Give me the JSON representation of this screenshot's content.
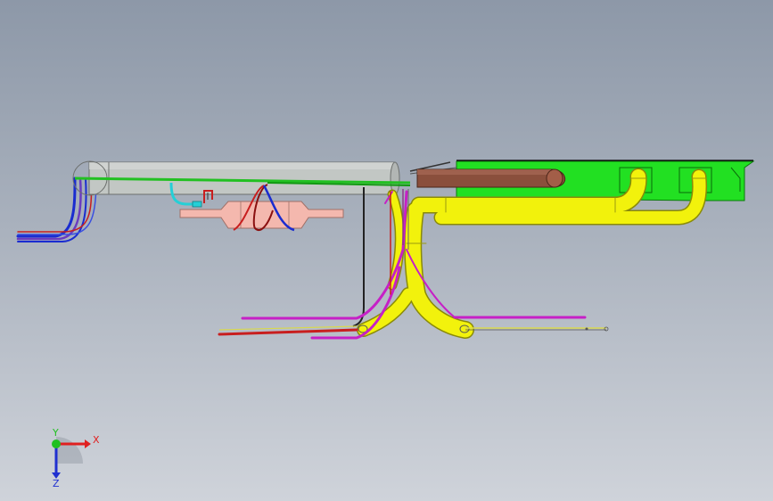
{
  "viewport": {
    "background_top": "#8d98a8",
    "background_bottom": "#cfd3da"
  },
  "model": {
    "parts": [
      "cylinder-tank",
      "end-cap-sphere",
      "green-bracket-plate",
      "brown-muffler",
      "pink-catalyst",
      "yellow-exhaust-pipes",
      "cyan-hose",
      "magenta-lines",
      "red-line",
      "blue-cables",
      "black-line"
    ],
    "colors": {
      "tank": "#c2c7c4",
      "plate": "#22e022",
      "muffler": "#8a4f3c",
      "catalyst": "#f4b8ae",
      "exhaust": "#f2f20c",
      "cyan": "#25cfd6",
      "magenta": "#c620c6",
      "red": "#c81e1e",
      "blue": "#1a2cd0",
      "black": "#222222"
    }
  },
  "triad": {
    "x_label": "X",
    "y_label": "Y",
    "z_label": "Z",
    "x_color": "#e02020",
    "y_color": "#20c020",
    "z_color": "#2030d0"
  }
}
